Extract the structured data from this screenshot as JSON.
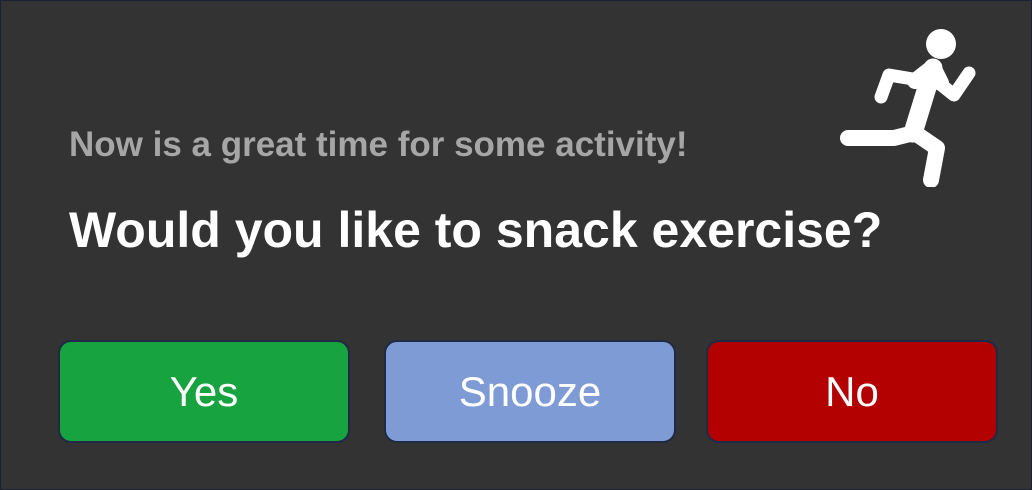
{
  "prompt": {
    "subtitle": "Now is a great time for some activity!",
    "question": "Would you like to snack exercise?",
    "icon": "running-person-icon"
  },
  "buttons": [
    {
      "label": "Yes",
      "color": "#17a33f"
    },
    {
      "label": "Snooze",
      "color": "#7f9bd5"
    },
    {
      "label": "No",
      "color": "#b30000"
    }
  ],
  "colors": {
    "background": "#333333",
    "subtitle": "#a6a6a6",
    "question": "#ffffff"
  }
}
